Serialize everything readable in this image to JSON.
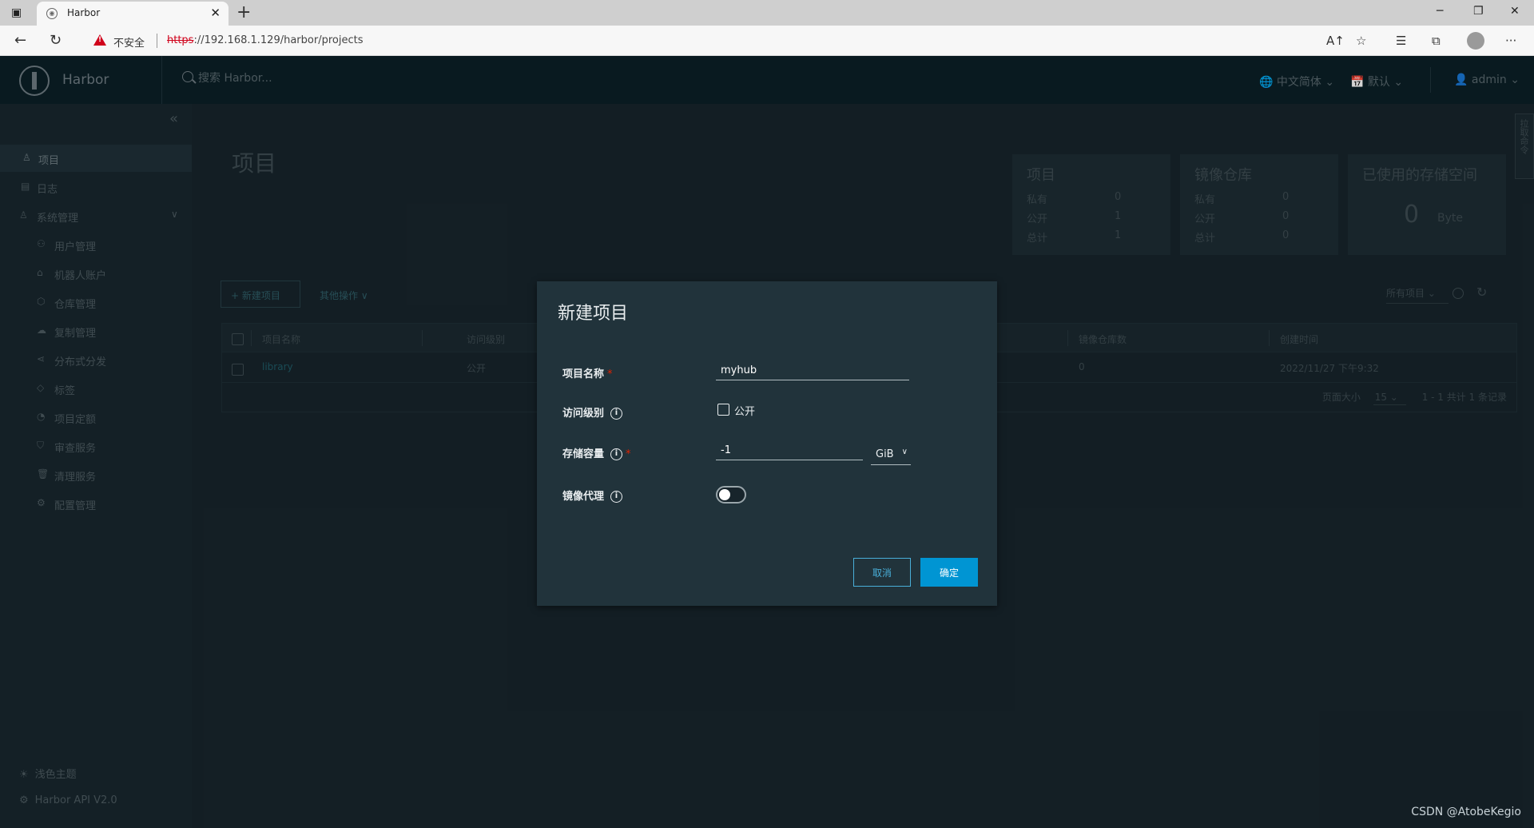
{
  "browser": {
    "tab_title": "Harbor",
    "tab_close": "✕",
    "new_tab": "+",
    "insecure_label": "不安全",
    "url_scheme": "https",
    "url_rest": "://192.168.1.129/harbor/projects"
  },
  "header": {
    "app_name": "Harbor",
    "search_placeholder": "搜索 Harbor...",
    "language": "中文简体",
    "date_format": "默认",
    "user": "admin"
  },
  "sidebar": {
    "items": [
      {
        "label": "项目"
      },
      {
        "label": "日志"
      },
      {
        "label": "系统管理"
      }
    ],
    "sub_items": [
      {
        "label": "用户管理"
      },
      {
        "label": "机器人账户"
      },
      {
        "label": "仓库管理"
      },
      {
        "label": "复制管理"
      },
      {
        "label": "分布式分发"
      },
      {
        "label": "标签"
      },
      {
        "label": "项目定额"
      },
      {
        "label": "审查服务"
      },
      {
        "label": "清理服务"
      },
      {
        "label": "配置管理"
      }
    ],
    "theme": "浅色主题",
    "api": "Harbor API V2.0"
  },
  "main": {
    "title": "项目",
    "stats": {
      "projects": {
        "title": "项目",
        "private_label": "私有",
        "private": "0",
        "public_label": "公开",
        "public": "1",
        "total_label": "总计",
        "total": "1"
      },
      "repos": {
        "title": "镜像仓库",
        "private_label": "私有",
        "private": "0",
        "public_label": "公开",
        "public": "0",
        "total_label": "总计",
        "total": "0"
      },
      "storage": {
        "title": "已使用的存储空间",
        "value": "0",
        "unit": "Byte"
      }
    },
    "new_project_btn": "+ 新建项目",
    "other_ops": "其他操作",
    "filter": "所有项目",
    "side_tab": "拉取命令",
    "table": {
      "columns": [
        "项目名称",
        "访问级别",
        "镜像仓库数",
        "创建时间"
      ],
      "rows": [
        {
          "name": "library",
          "access": "公开",
          "repo_count": "0",
          "created": "2022/11/27 下午9:32"
        }
      ],
      "page_size_label": "页面大小",
      "page_size": "15",
      "summary": "1 - 1 共计 1 条记录"
    }
  },
  "modal": {
    "title": "新建项目",
    "name_label": "项目名称",
    "name_value": "myhub",
    "access_label": "访问级别",
    "public_label": "公开",
    "quota_label": "存储容量",
    "quota_value": "-1",
    "quota_unit": "GiB",
    "proxy_label": "镜像代理",
    "cancel": "取消",
    "ok": "确定"
  },
  "watermark": "CSDN @AtobeKegio"
}
